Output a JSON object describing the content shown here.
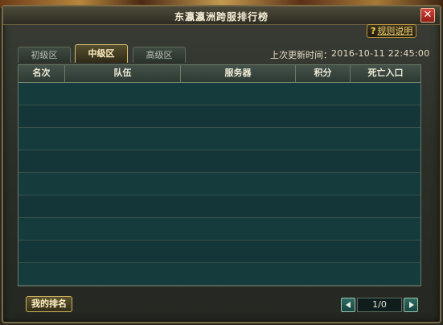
{
  "window": {
    "title": "东瀛瀛洲跨服排行榜",
    "help_label": "规则说明",
    "help_prefix": "?"
  },
  "tabs": [
    {
      "label": "初级区",
      "active": false
    },
    {
      "label": "中级区",
      "active": true
    },
    {
      "label": "高级区",
      "active": false
    }
  ],
  "update": {
    "label": "上次更新时间：",
    "value": "2016-10-11 22:45:00"
  },
  "table": {
    "columns": [
      "名次",
      "队伍",
      "服务器",
      "积分",
      "死亡入口"
    ],
    "rows": []
  },
  "footer": {
    "my_rank_label": "我的排名",
    "page_indicator": "1/0"
  }
}
